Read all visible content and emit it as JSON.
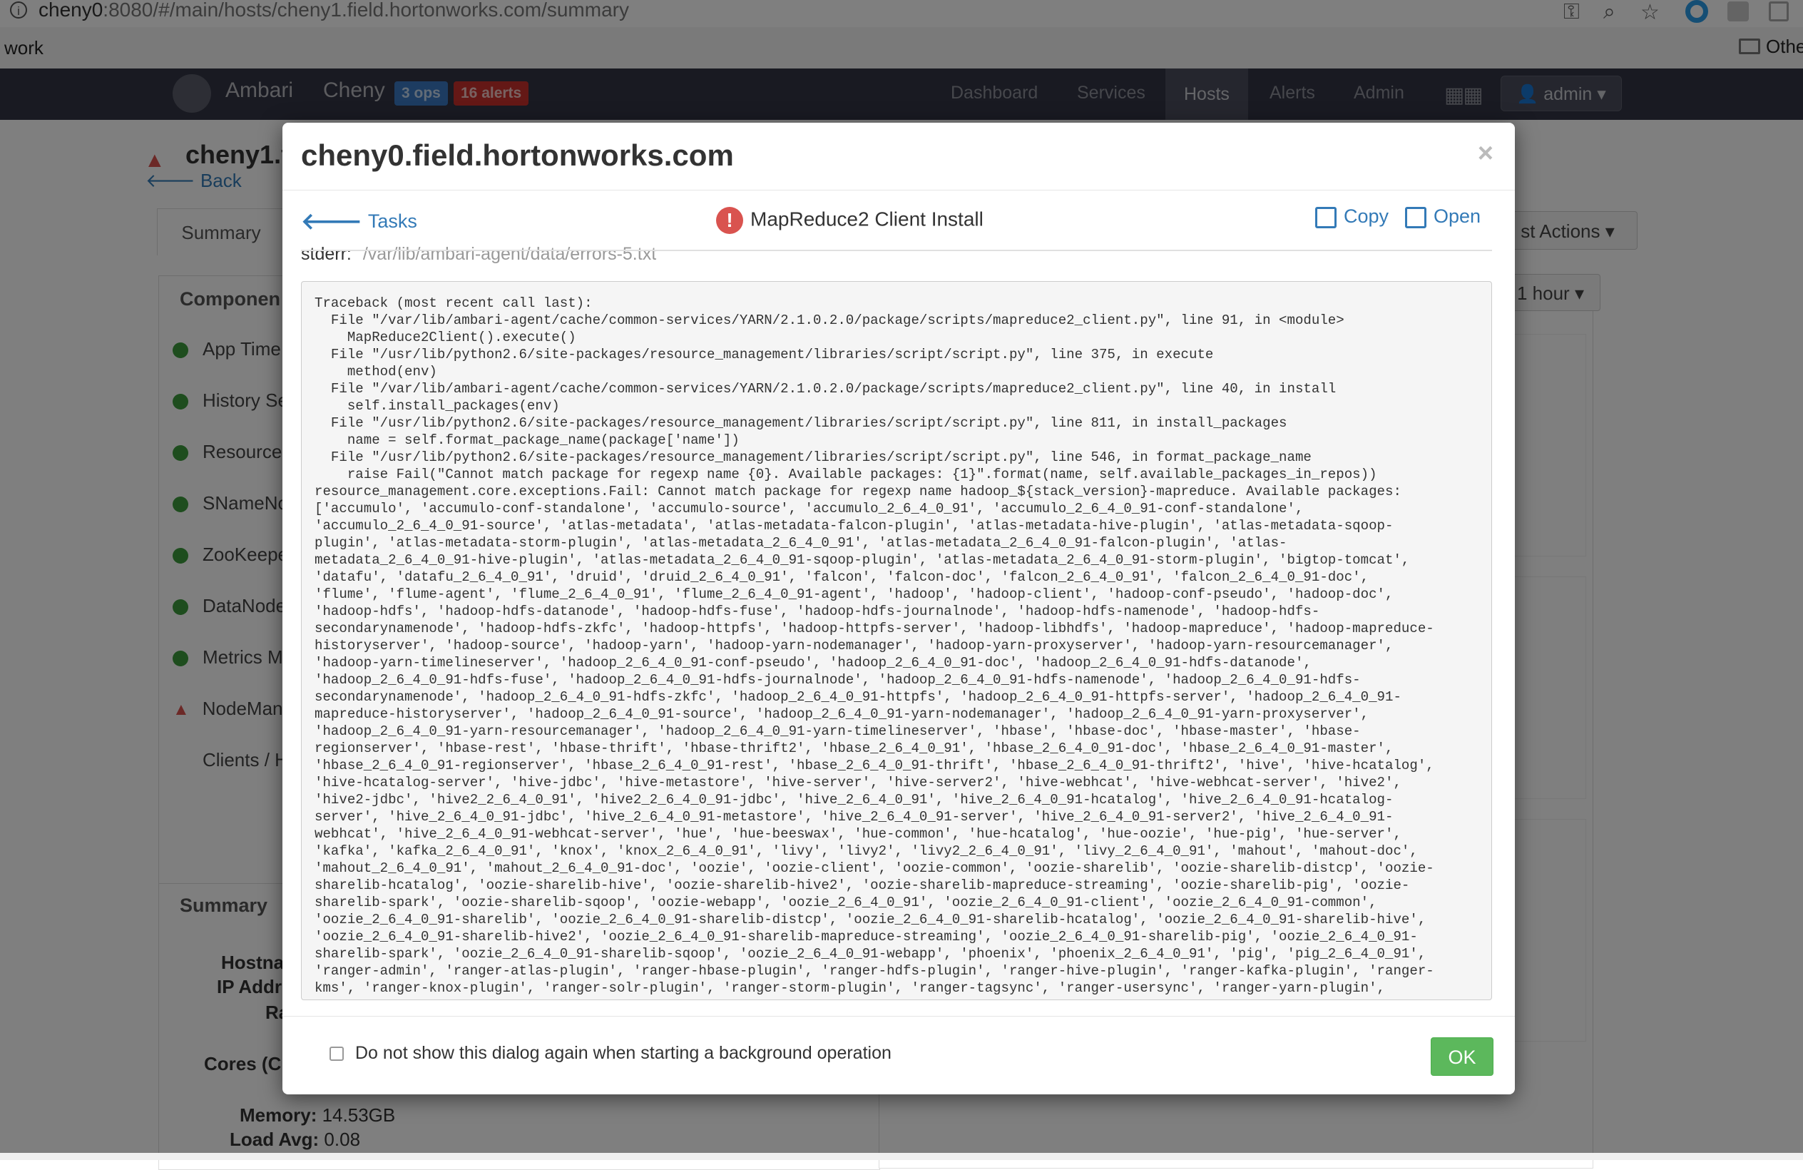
{
  "browser": {
    "url_host": "cheny0",
    "url_rest": ":8080/#/main/hosts/cheny1.field.hortonworks.com/summary",
    "bookmark_work": "work",
    "bookmark_other": "Othe"
  },
  "nav": {
    "brand": "Ambari",
    "cluster": "Cheny",
    "ops_badge": "3 ops",
    "alerts_badge": "16 alerts",
    "links": [
      "Dashboard",
      "Services",
      "Hosts",
      "Alerts",
      "Admin"
    ],
    "active_link": "Hosts",
    "user_label": "admin"
  },
  "page": {
    "host_title": "cheny1.fi",
    "back_label": "Back",
    "tab_summary": "Summary",
    "components_title": "Componen",
    "components": [
      {
        "label": "App Time",
        "status": "ok"
      },
      {
        "label": "History Se",
        "status": "ok"
      },
      {
        "label": "Resource",
        "status": "ok"
      },
      {
        "label": "SNameNo",
        "status": "ok"
      },
      {
        "label": "ZooKeepe",
        "status": "ok"
      },
      {
        "label": "DataNode",
        "status": "ok"
      },
      {
        "label": "Metrics M",
        "status": "ok"
      },
      {
        "label": "NodeMan",
        "status": "warning"
      },
      {
        "label": "Clients / H",
        "status": "none"
      }
    ],
    "summary_title": "Summary",
    "summary_rows": [
      "Hostna",
      "IP Addr",
      "Ra"
    ],
    "cores_label": "Cores (C",
    "memory_label": "Memory:",
    "memory_value": "14.53GB",
    "load_label": "Load Avg:",
    "load_value": "0.08",
    "host_actions": "st Actions",
    "time_range": "1 hour"
  },
  "modal": {
    "title": "cheny0.field.hortonworks.com",
    "close": "×",
    "tasks_label": "Tasks",
    "task_title": "MapReduce2 Client Install",
    "copy_label": "Copy",
    "open_label": "Open",
    "stderr_label": "stderr:",
    "stderr_path": "/var/lib/ambari-agent/data/errors-5.txt",
    "log": "Traceback (most recent call last):\n  File \"/var/lib/ambari-agent/cache/common-services/YARN/2.1.0.2.0/package/scripts/mapreduce2_client.py\", line 91, in <module>\n    MapReduce2Client().execute()\n  File \"/usr/lib/python2.6/site-packages/resource_management/libraries/script/script.py\", line 375, in execute\n    method(env)\n  File \"/var/lib/ambari-agent/cache/common-services/YARN/2.1.0.2.0/package/scripts/mapreduce2_client.py\", line 40, in install\n    self.install_packages(env)\n  File \"/usr/lib/python2.6/site-packages/resource_management/libraries/script/script.py\", line 811, in install_packages\n    name = self.format_package_name(package['name'])\n  File \"/usr/lib/python2.6/site-packages/resource_management/libraries/script/script.py\", line 546, in format_package_name\n    raise Fail(\"Cannot match package for regexp name {0}. Available packages: {1}\".format(name, self.available_packages_in_repos))\nresource_management.core.exceptions.Fail: Cannot match package for regexp name hadoop_${stack_version}-mapreduce. Available packages:\n['accumulo', 'accumulo-conf-standalone', 'accumulo-source', 'accumulo_2_6_4_0_91', 'accumulo_2_6_4_0_91-conf-standalone',\n'accumulo_2_6_4_0_91-source', 'atlas-metadata', 'atlas-metadata-falcon-plugin', 'atlas-metadata-hive-plugin', 'atlas-metadata-sqoop-\nplugin', 'atlas-metadata-storm-plugin', 'atlas-metadata_2_6_4_0_91', 'atlas-metadata_2_6_4_0_91-falcon-plugin', 'atlas-\nmetadata_2_6_4_0_91-hive-plugin', 'atlas-metadata_2_6_4_0_91-sqoop-plugin', 'atlas-metadata_2_6_4_0_91-storm-plugin', 'bigtop-tomcat',\n'datafu', 'datafu_2_6_4_0_91', 'druid', 'druid_2_6_4_0_91', 'falcon', 'falcon-doc', 'falcon_2_6_4_0_91', 'falcon_2_6_4_0_91-doc',\n'flume', 'flume-agent', 'flume_2_6_4_0_91', 'flume_2_6_4_0_91-agent', 'hadoop', 'hadoop-client', 'hadoop-conf-pseudo', 'hadoop-doc',\n'hadoop-hdfs', 'hadoop-hdfs-datanode', 'hadoop-hdfs-fuse', 'hadoop-hdfs-journalnode', 'hadoop-hdfs-namenode', 'hadoop-hdfs-\nsecondarynamenode', 'hadoop-hdfs-zkfc', 'hadoop-httpfs', 'hadoop-httpfs-server', 'hadoop-libhdfs', 'hadoop-mapreduce', 'hadoop-mapreduce-\nhistoryserver', 'hadoop-source', 'hadoop-yarn', 'hadoop-yarn-nodemanager', 'hadoop-yarn-proxyserver', 'hadoop-yarn-resourcemanager',\n'hadoop-yarn-timelineserver', 'hadoop_2_6_4_0_91-conf-pseudo', 'hadoop_2_6_4_0_91-doc', 'hadoop_2_6_4_0_91-hdfs-datanode',\n'hadoop_2_6_4_0_91-hdfs-fuse', 'hadoop_2_6_4_0_91-hdfs-journalnode', 'hadoop_2_6_4_0_91-hdfs-namenode', 'hadoop_2_6_4_0_91-hdfs-\nsecondarynamenode', 'hadoop_2_6_4_0_91-hdfs-zkfc', 'hadoop_2_6_4_0_91-httpfs', 'hadoop_2_6_4_0_91-httpfs-server', 'hadoop_2_6_4_0_91-\nmapreduce-historyserver', 'hadoop_2_6_4_0_91-source', 'hadoop_2_6_4_0_91-yarn-nodemanager', 'hadoop_2_6_4_0_91-yarn-proxyserver',\n'hadoop_2_6_4_0_91-yarn-resourcemanager', 'hadoop_2_6_4_0_91-yarn-timelineserver', 'hbase', 'hbase-doc', 'hbase-master', 'hbase-\nregionserver', 'hbase-rest', 'hbase-thrift', 'hbase-thrift2', 'hbase_2_6_4_0_91', 'hbase_2_6_4_0_91-doc', 'hbase_2_6_4_0_91-master',\n'hbase_2_6_4_0_91-regionserver', 'hbase_2_6_4_0_91-rest', 'hbase_2_6_4_0_91-thrift', 'hbase_2_6_4_0_91-thrift2', 'hive', 'hive-hcatalog',\n'hive-hcatalog-server', 'hive-jdbc', 'hive-metastore', 'hive-server', 'hive-server2', 'hive-webhcat', 'hive-webhcat-server', 'hive2',\n'hive2-jdbc', 'hive2_2_6_4_0_91', 'hive2_2_6_4_0_91-jdbc', 'hive_2_6_4_0_91', 'hive_2_6_4_0_91-hcatalog', 'hive_2_6_4_0_91-hcatalog-\nserver', 'hive_2_6_4_0_91-jdbc', 'hive_2_6_4_0_91-metastore', 'hive_2_6_4_0_91-server', 'hive_2_6_4_0_91-server2', 'hive_2_6_4_0_91-\nwebhcat', 'hive_2_6_4_0_91-webhcat-server', 'hue', 'hue-beeswax', 'hue-common', 'hue-hcatalog', 'hue-oozie', 'hue-pig', 'hue-server',\n'kafka', 'kafka_2_6_4_0_91', 'knox', 'knox_2_6_4_0_91', 'livy', 'livy2', 'livy2_2_6_4_0_91', 'livy_2_6_4_0_91', 'mahout', 'mahout-doc',\n'mahout_2_6_4_0_91', 'mahout_2_6_4_0_91-doc', 'oozie', 'oozie-client', 'oozie-common', 'oozie-sharelib', 'oozie-sharelib-distcp', 'oozie-\nsharelib-hcatalog', 'oozie-sharelib-hive', 'oozie-sharelib-hive2', 'oozie-sharelib-mapreduce-streaming', 'oozie-sharelib-pig', 'oozie-\nsharelib-spark', 'oozie-sharelib-sqoop', 'oozie-webapp', 'oozie_2_6_4_0_91', 'oozie_2_6_4_0_91-client', 'oozie_2_6_4_0_91-common',\n'oozie_2_6_4_0_91-sharelib', 'oozie_2_6_4_0_91-sharelib-distcp', 'oozie_2_6_4_0_91-sharelib-hcatalog', 'oozie_2_6_4_0_91-sharelib-hive',\n'oozie_2_6_4_0_91-sharelib-hive2', 'oozie_2_6_4_0_91-sharelib-mapreduce-streaming', 'oozie_2_6_4_0_91-sharelib-pig', 'oozie_2_6_4_0_91-\nsharelib-spark', 'oozie_2_6_4_0_91-sharelib-sqoop', 'oozie_2_6_4_0_91-webapp', 'phoenix', 'phoenix_2_6_4_0_91', 'pig', 'pig_2_6_4_0_91',\n'ranger-admin', 'ranger-atlas-plugin', 'ranger-hbase-plugin', 'ranger-hdfs-plugin', 'ranger-hive-plugin', 'ranger-kafka-plugin', 'ranger-\nkms', 'ranger-knox-plugin', 'ranger-solr-plugin', 'ranger-storm-plugin', 'ranger-tagsync', 'ranger-usersync', 'ranger-yarn-plugin',",
    "checkbox_label": "Do not show this dialog again when starting a background operation",
    "ok_label": "OK"
  },
  "colors": {
    "nav_bg": "#323544",
    "link": "#337ab7",
    "ok_green": "#5cb85c",
    "error_red": "#d9534f",
    "badge_ops": "#3a78c2",
    "badge_alerts": "#c9302c"
  }
}
